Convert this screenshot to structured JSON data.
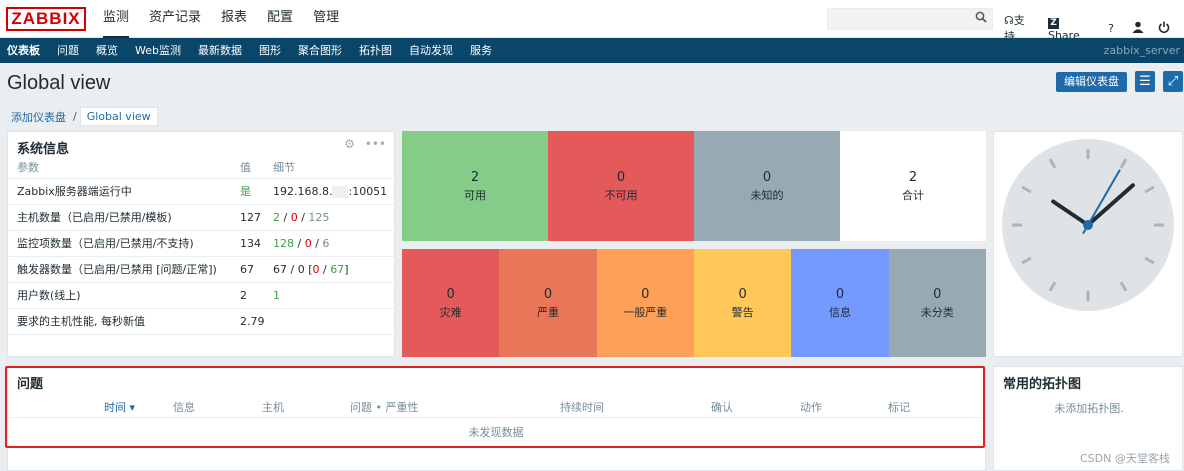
{
  "topbar": {
    "logo": "ZABBIX",
    "menu": [
      "监测",
      "资产记录",
      "报表",
      "配置",
      "管理"
    ],
    "search_placeholder": "",
    "support": "支持",
    "share": "Share",
    "help": "?"
  },
  "subnav": {
    "items": [
      "仪表板",
      "问题",
      "概览",
      "Web监测",
      "最新数据",
      "图形",
      "聚合图形",
      "拓扑图",
      "自动发现",
      "服务"
    ],
    "server": "zabbix_server"
  },
  "page": {
    "title": "Global view",
    "edit_button": "编辑仪表盘",
    "breadcrumb": [
      "添加仪表盘",
      "Global view"
    ]
  },
  "sysinfo": {
    "title": "系统信息",
    "columns": [
      "参数",
      "值",
      "细节"
    ],
    "rows": [
      {
        "param": "Zabbix服务器端运行中",
        "value": "是",
        "d1": "192.168.8.",
        "d2": "",
        "d3": ":10051",
        "d4": "",
        "d5": ""
      },
      {
        "param": "主机数量（已启用/已禁用/模板)",
        "value": "127",
        "d1": "2",
        "d2": " / ",
        "d3": "0",
        "d4": " / ",
        "d5": "125"
      },
      {
        "param": "监控项数量（已启用/已禁用/不支持)",
        "value": "134",
        "d1": "128",
        "d2": " / ",
        "d3": "0",
        "d4": " / ",
        "d5": "6"
      },
      {
        "param": "触发器数量（已启用/已禁用 [问题/正常])",
        "value": "67",
        "d1": "67 / 0 [",
        "d2": "0",
        "d3": " / ",
        "d4": "67",
        "d5": "]"
      },
      {
        "param": "用户数(线上)",
        "value": "2",
        "d1": "1",
        "d2": "",
        "d3": "",
        "d4": "",
        "d5": ""
      },
      {
        "param": "要求的主机性能, 每秒新值",
        "value": "2.79",
        "d1": "",
        "d2": "",
        "d3": "",
        "d4": "",
        "d5": ""
      }
    ]
  },
  "host_availability": [
    {
      "count": "2",
      "label": "可用",
      "color": "#86cc89"
    },
    {
      "count": "0",
      "label": "不可用",
      "color": "#e45959"
    },
    {
      "count": "0",
      "label": "未知的",
      "color": "#97aab3"
    },
    {
      "count": "2",
      "label": "合计",
      "color": "#ffffff"
    }
  ],
  "problem_severity": [
    {
      "count": "0",
      "label": "灾难",
      "color": "#e45959"
    },
    {
      "count": "0",
      "label": "严重",
      "color": "#e97659"
    },
    {
      "count": "0",
      "label": "一般严重",
      "color": "#ffa059"
    },
    {
      "count": "0",
      "label": "警告",
      "color": "#ffc859"
    },
    {
      "count": "0",
      "label": "信息",
      "color": "#7499ff"
    },
    {
      "count": "0",
      "label": "未分类",
      "color": "#97aab3"
    }
  ],
  "clock": {
    "hour": 10,
    "minute": 8,
    "second": 5
  },
  "problems": {
    "title": "问题",
    "columns": [
      "时间 ▾",
      "信息",
      "主机",
      "问题 • 严重性",
      "持续时间",
      "确认",
      "动作",
      "标记"
    ],
    "empty": "未发现数据"
  },
  "maps": {
    "title": "常用的拓扑图",
    "empty": "未添加拓扑图."
  },
  "watermark": "CSDN @天堂客栈"
}
